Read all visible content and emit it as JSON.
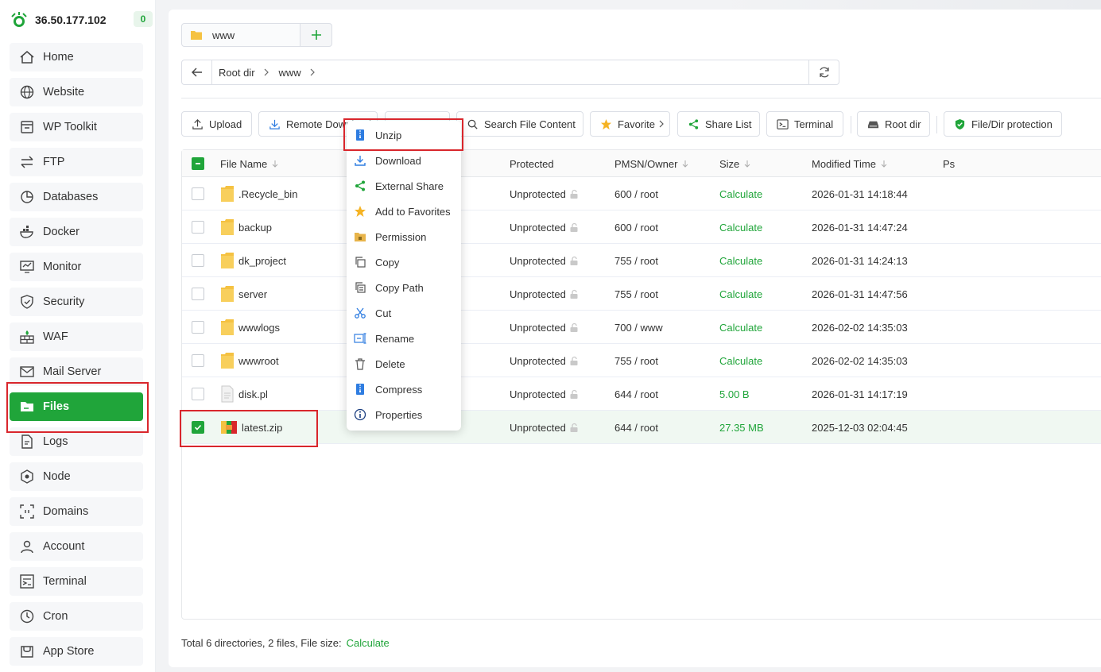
{
  "server": {
    "ip": "36.50.177.102",
    "badge": "0"
  },
  "sidebar": {
    "items": [
      {
        "label": "Home",
        "icon": "home-icon"
      },
      {
        "label": "Website",
        "icon": "globe-icon"
      },
      {
        "label": "WP Toolkit",
        "icon": "wordpress-icon"
      },
      {
        "label": "FTP",
        "icon": "transfer-icon"
      },
      {
        "label": "Databases",
        "icon": "database-icon"
      },
      {
        "label": "Docker",
        "icon": "docker-icon"
      },
      {
        "label": "Monitor",
        "icon": "monitor-icon"
      },
      {
        "label": "Security",
        "icon": "shield-icon"
      },
      {
        "label": "WAF",
        "icon": "firewall-icon"
      },
      {
        "label": "Mail Server",
        "icon": "mail-icon"
      },
      {
        "label": "Files",
        "icon": "folder-icon",
        "active": true
      },
      {
        "label": "Logs",
        "icon": "logs-icon"
      },
      {
        "label": "Node",
        "icon": "node-icon"
      },
      {
        "label": "Domains",
        "icon": "domain-icon"
      },
      {
        "label": "Account",
        "icon": "user-icon"
      },
      {
        "label": "Terminal",
        "icon": "terminal-icon"
      },
      {
        "label": "Cron",
        "icon": "clock-icon"
      },
      {
        "label": "App Store",
        "icon": "store-icon"
      }
    ]
  },
  "tabs": {
    "current": "www",
    "add": "+"
  },
  "path": {
    "crumbs": [
      "Root dir",
      "www"
    ]
  },
  "toolbar": {
    "upload": "Upload",
    "remote_download": "Remote Download",
    "search_content": "Search File Content",
    "favorite": "Favorite",
    "share_list": "Share List",
    "terminal": "Terminal",
    "root_dir": "Root dir",
    "protection": "File/Dir protection"
  },
  "table": {
    "columns": {
      "name": "File Name",
      "protected": "Protected",
      "perm": "PMSN/Owner",
      "size": "Size",
      "modified": "Modified Time",
      "ps": "Ps"
    },
    "rows": [
      {
        "name": ".Recycle_bin",
        "type": "folder",
        "protected": "Unprotected",
        "perm": "600 / root",
        "size": "Calculate",
        "modified": "2026-01-31 14:18:44"
      },
      {
        "name": "backup",
        "type": "folder",
        "protected": "Unprotected",
        "perm": "600 / root",
        "size": "Calculate",
        "modified": "2026-01-31 14:47:24"
      },
      {
        "name": "dk_project",
        "type": "folder",
        "protected": "Unprotected",
        "perm": "755 / root",
        "size": "Calculate",
        "modified": "2026-01-31 14:24:13"
      },
      {
        "name": "server",
        "type": "folder",
        "protected": "Unprotected",
        "perm": "755 / root",
        "size": "Calculate",
        "modified": "2026-01-31 14:47:56"
      },
      {
        "name": "wwwlogs",
        "type": "folder",
        "protected": "Unprotected",
        "perm": "700 / www",
        "size": "Calculate",
        "modified": "2026-02-02 14:35:03"
      },
      {
        "name": "wwwroot",
        "type": "folder",
        "protected": "Unprotected",
        "perm": "755 / root",
        "size": "Calculate",
        "modified": "2026-02-02 14:35:03"
      },
      {
        "name": "disk.pl",
        "type": "file",
        "protected": "Unprotected",
        "perm": "644 / root",
        "size": "5.00 B",
        "modified": "2026-01-31 14:17:19"
      },
      {
        "name": "latest.zip",
        "type": "zip",
        "protected": "Unprotected",
        "perm": "644 / root",
        "size": "27.35 MB",
        "modified": "2025-12-03 02:04:45",
        "selected": true
      }
    ]
  },
  "footer": {
    "summary": "Total 6 directories, 2 files, File size:",
    "calc": "Calculate"
  },
  "context_menu": {
    "items": [
      {
        "label": "Unzip",
        "icon": "unzip-icon"
      },
      {
        "label": "Download",
        "icon": "download-icon"
      },
      {
        "label": "External Share",
        "icon": "share-icon"
      },
      {
        "label": "Add to Favorites",
        "icon": "star-icon"
      },
      {
        "label": "Permission",
        "icon": "permission-icon"
      },
      {
        "label": "Copy",
        "icon": "copy-icon"
      },
      {
        "label": "Copy Path",
        "icon": "copy-path-icon"
      },
      {
        "label": "Cut",
        "icon": "scissors-icon"
      },
      {
        "label": "Rename",
        "icon": "rename-icon"
      },
      {
        "label": "Delete",
        "icon": "trash-icon"
      },
      {
        "label": "Compress",
        "icon": "compress-icon"
      },
      {
        "label": "Properties",
        "icon": "info-icon"
      }
    ]
  },
  "colors": {
    "brand": "#20a53a",
    "highlight": "#d9262c",
    "folder": "#f5c242"
  }
}
